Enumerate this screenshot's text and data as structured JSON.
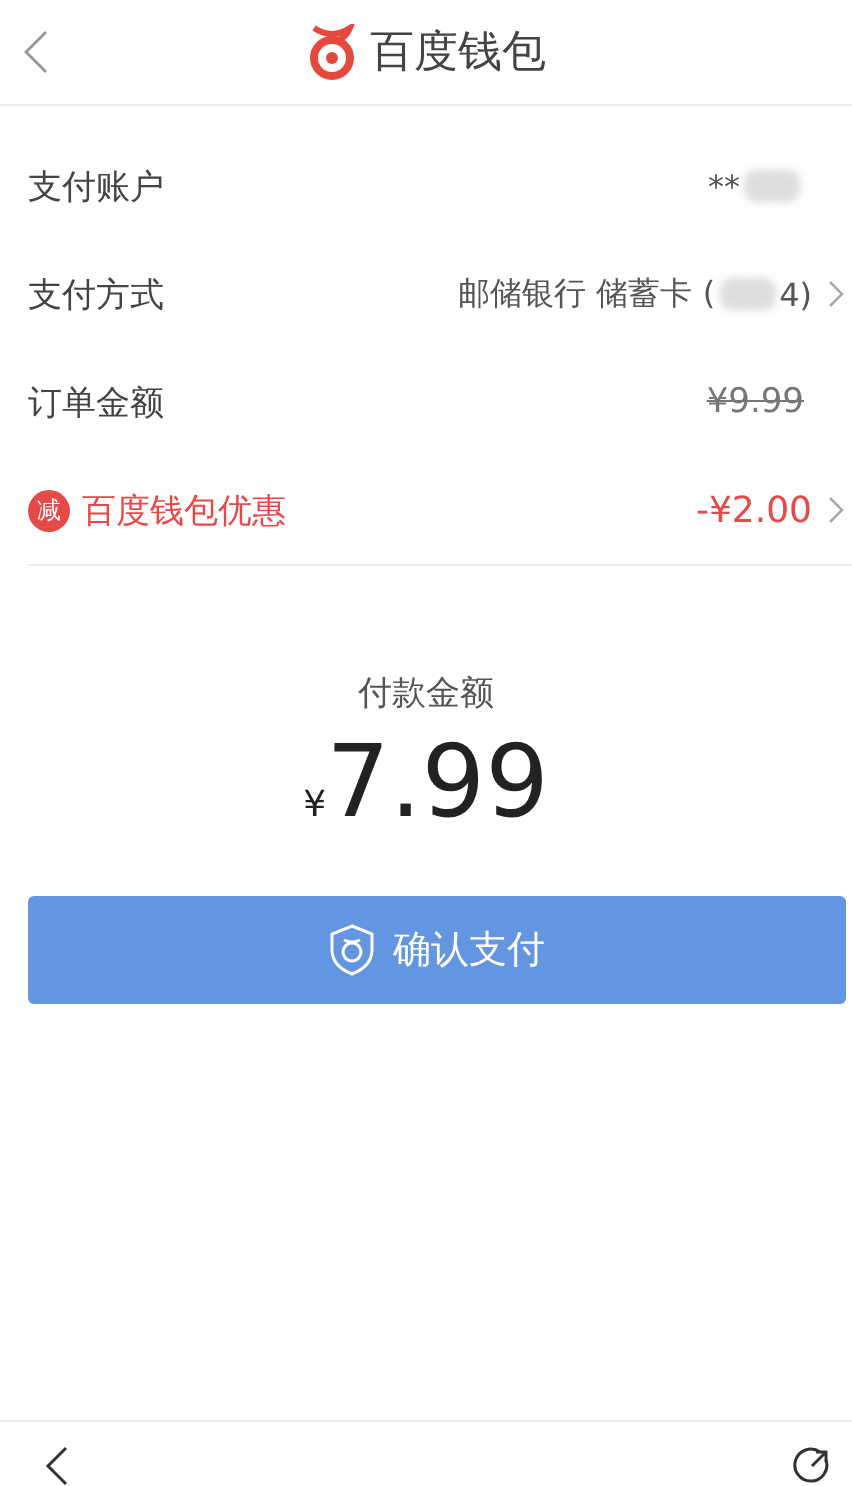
{
  "header": {
    "title": "百度钱包"
  },
  "rows": [
    {
      "kind": "plain",
      "label": "支付账户",
      "value": "**",
      "blurred": true,
      "chevron": false
    },
    {
      "kind": "plain",
      "label": "支付方式",
      "value": "邮储银行 储蓄卡 (",
      "blurred": true,
      "value_end": "4)",
      "chevron": true
    },
    {
      "kind": "strike",
      "label": "订单金额",
      "value": "¥9.99",
      "chevron": false
    },
    {
      "kind": "discount",
      "badge": "减",
      "label": "百度钱包优惠",
      "value": "-¥2.00",
      "chevron": true
    }
  ],
  "payment": {
    "label": "付款金额",
    "currency": "¥",
    "amount": "7.99"
  },
  "confirm_button": {
    "label": "确认支付"
  }
}
